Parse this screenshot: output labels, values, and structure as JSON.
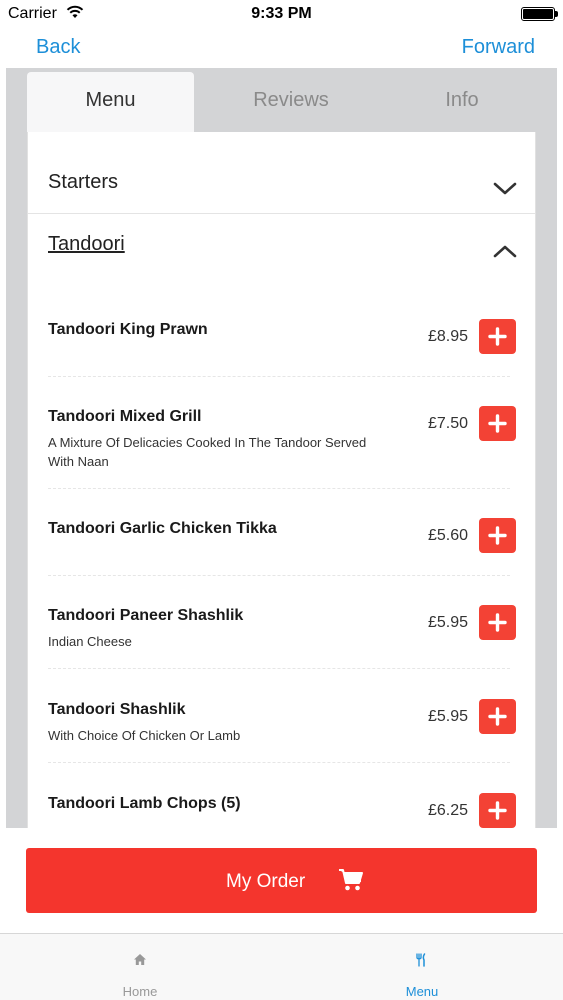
{
  "status_bar": {
    "carrier": "Carrier",
    "time": "9:33 PM"
  },
  "nav": {
    "back": "Back",
    "forward": "Forward"
  },
  "tabs": [
    {
      "label": "Menu",
      "active": true
    },
    {
      "label": "Reviews",
      "active": false
    },
    {
      "label": "Info",
      "active": false
    }
  ],
  "sections": {
    "starters": {
      "title": "Starters",
      "expanded": false
    },
    "tandoori": {
      "title": "Tandoori",
      "expanded": true
    }
  },
  "items": [
    {
      "name": "Tandoori King Prawn",
      "desc": "",
      "price": "£8.95"
    },
    {
      "name": "Tandoori Mixed Grill",
      "desc": "A Mixture Of Delicacies Cooked In The Tandoor Served With Naan",
      "price": "£7.50"
    },
    {
      "name": "Tandoori Garlic Chicken Tikka",
      "desc": "",
      "price": "£5.60"
    },
    {
      "name": "Tandoori Paneer Shashlik",
      "desc": "Indian Cheese",
      "price": "£5.95"
    },
    {
      "name": "Tandoori Shashlik",
      "desc": "With Choice Of Chicken Or Lamb",
      "price": "£5.95"
    },
    {
      "name": "Tandoori Lamb Chops (5)",
      "desc": "",
      "price": "£6.25"
    }
  ],
  "order_button": {
    "label": "My Order",
    "icon": "cart-icon"
  },
  "tab_bar": [
    {
      "label": "Home",
      "icon": "home-icon",
      "active": false
    },
    {
      "label": "Menu",
      "icon": "cutlery-icon",
      "active": true
    }
  ],
  "colors": {
    "accent": "#1d8fd8",
    "add_button": "#f34235",
    "order_button": "#f4352d"
  }
}
